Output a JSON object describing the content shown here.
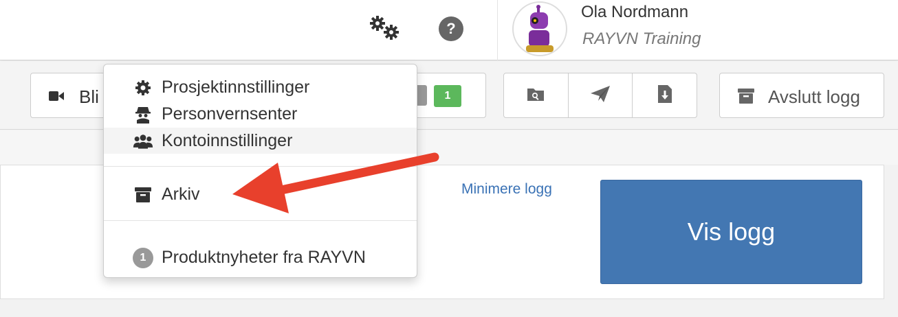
{
  "header": {
    "settings_icon": "gears-icon",
    "help_label": "?",
    "user": {
      "name": "Ola Nordmann",
      "organization": "RAYVN Training",
      "avatar_icon": "robot-avatar"
    }
  },
  "toolbar": {
    "bli_label": "Bli",
    "badge_count": "1",
    "action_icons": [
      "search-file-icon",
      "paper-plane-icon",
      "download-file-icon"
    ],
    "avslutt_label": "Avslutt logg"
  },
  "menu": {
    "items": [
      {
        "label": "Prosjektinnstillinger",
        "icon": "gear-icon"
      },
      {
        "label": "Personvernsenter",
        "icon": "spy-icon"
      },
      {
        "label": "Kontoinnstillinger",
        "icon": "users-icon"
      },
      {
        "label": "Arkiv",
        "icon": "archive-icon"
      },
      {
        "label": "Produktnyheter fra RAYVN",
        "badge": "1"
      }
    ]
  },
  "main": {
    "minimize_label": "Minimere logg",
    "show_log_label": "Vis logg"
  },
  "colors": {
    "primary": "#4377b2",
    "link": "#3a72b5",
    "success": "#5cb85c",
    "annotation_arrow": "#e8402c"
  }
}
